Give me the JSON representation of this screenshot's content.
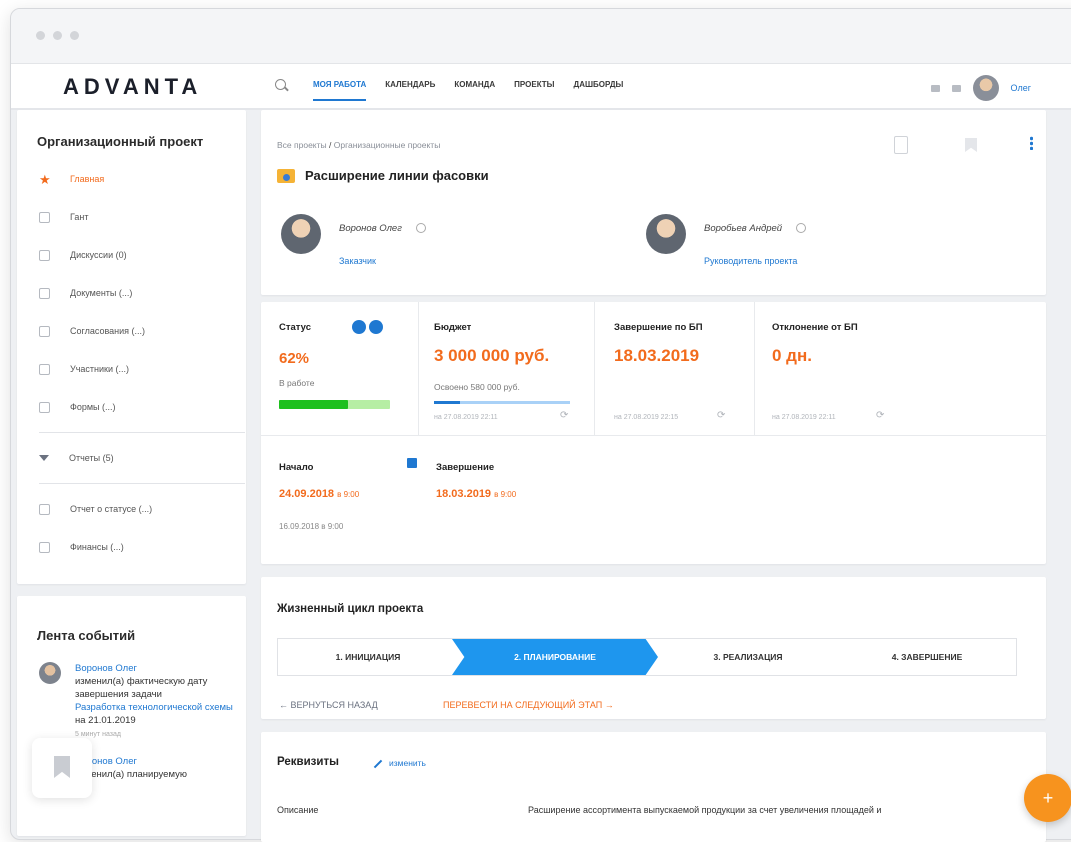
{
  "app": {
    "logo": "ADVANTA"
  },
  "nav": {
    "items": [
      "МОЯ РАБОТА",
      "КАЛЕНДАРЬ",
      "КОМАНДА",
      "ПРОЕКТЫ",
      "ДАШБОРДЫ"
    ],
    "active": "МОЯ РАБОТА",
    "user_name": "Олег"
  },
  "sidebar": {
    "title": "Организационный проект",
    "items": [
      {
        "label": "Главная",
        "icon": "star-icon",
        "active": true
      },
      {
        "label": "Гант",
        "icon": "gantt-icon"
      },
      {
        "label": "Дискуссии (0)",
        "icon": "chat-icon"
      },
      {
        "label": "Документы (...)",
        "icon": "document-icon"
      },
      {
        "label": "Согласования (...)",
        "icon": "approval-icon"
      },
      {
        "label": "Участники (...)",
        "icon": "users-icon"
      },
      {
        "label": "Формы (...)",
        "icon": "form-icon"
      }
    ],
    "reports": "Отчеты (5)",
    "report_items": [
      {
        "label": "Отчет о статусе (...)",
        "icon": "report-icon"
      },
      {
        "label": "Финансы (...)",
        "icon": "finance-icon"
      }
    ]
  },
  "feed": {
    "title": "Лента событий",
    "items": [
      {
        "author": "Воронов Олег",
        "action": "изменил(а) фактическую дату завершения задачи",
        "target": "Разработка технологической схемы",
        "suffix": "на 21.01.2019",
        "time": "5 минут назад"
      },
      {
        "author": "Воронов Олег",
        "action": "изменил(а) планируемую"
      }
    ]
  },
  "project": {
    "breadcrumb_root": "Все проекты",
    "breadcrumb_current": "Организационные проекты",
    "title": "Расширение линии фасовки",
    "customer_name": "Воронов Олег",
    "customer_role": "Заказчик",
    "manager_name": "Воробьев Андрей",
    "manager_role": "Руководитель проекта"
  },
  "stats": {
    "status_label": "Статус",
    "status_value": "62%",
    "status_text": "В работе",
    "status_progress": 0.62,
    "budget_label": "Бюджет",
    "budget_value": "3 000 000 руб.",
    "budget_spent": "Освоено 580 000 руб.",
    "budget_progress": 0.19,
    "budget_ts": "на 27.08.2019 22:11",
    "end_bp_label": "Завершение по БП",
    "end_bp_value": "18.03.2019",
    "end_bp_ts": "на 27.08.2019 22:15",
    "dev_label": "Отклонение от БП",
    "dev_value": "0 дн.",
    "dev_ts": "на 27.08.2019 22:11"
  },
  "dates": {
    "start_label": "Начало",
    "start_value": "24.09.2018",
    "start_time": "в 9:00",
    "start_sub": "16.09.2018 в 9:00",
    "end_label": "Завершение",
    "end_value": "18.03.2019",
    "end_time": "в 9:00"
  },
  "lifecycle": {
    "title": "Жизненный цикл проекта",
    "stages": [
      "1. ИНИЦИАЦИЯ",
      "2. ПЛАНИРОВАНИЕ",
      "3. РЕАЛИЗАЦИЯ",
      "4. ЗАВЕРШЕНИЕ"
    ],
    "active_stage": 1,
    "back_label": "ВЕРНУТЬСЯ НАЗАД",
    "next_label": "ПЕРЕВЕСТИ НА СЛЕДУЮЩИЙ ЭТАП"
  },
  "requisites": {
    "title": "Реквизиты",
    "edit_label": "изменить",
    "desc_label": "Описание",
    "desc_value": "Расширение ассортимента выпускаемой продукции за счет увеличения площадей и"
  },
  "colors": {
    "accent": "#1f78d1",
    "orange": "#f26b1d",
    "green": "#1ec01e"
  }
}
